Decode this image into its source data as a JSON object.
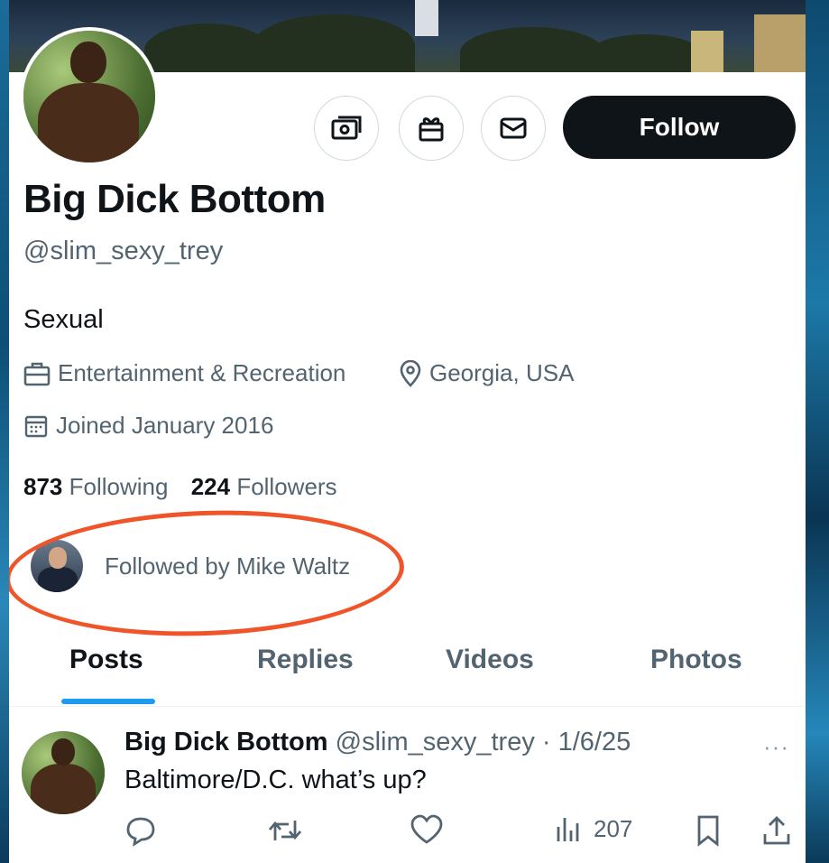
{
  "profile": {
    "display_name": "Big Dick Bottom",
    "handle": "@slim_sexy_trey",
    "bio": "Sexual",
    "category": "Entertainment & Recreation",
    "location": "Georgia, USA",
    "joined": "Joined January 2016",
    "following_count": "873",
    "following_label": "Following",
    "followers_count": "224",
    "followers_label": "Followers",
    "followed_by": "Followed by Mike Waltz"
  },
  "actions": {
    "follow_label": "Follow",
    "icons": [
      "money-icon",
      "gift-icon",
      "mail-icon"
    ]
  },
  "tabs": [
    {
      "label": "Posts",
      "active": true
    },
    {
      "label": "Replies",
      "active": false
    },
    {
      "label": "Videos",
      "active": false
    },
    {
      "label": "Photos",
      "active": false
    }
  ],
  "post": {
    "author": "Big Dick Bottom",
    "meta": "@slim_sexy_trey · 1/6/25",
    "more": "···",
    "text": "Baltimore/D.C. what’s up?",
    "views": "207"
  },
  "colors": {
    "accent": "#1d9bf0",
    "follow_button": "#0f1419",
    "annotation_oval": "#f0552a",
    "secondary_text": "#536471"
  }
}
